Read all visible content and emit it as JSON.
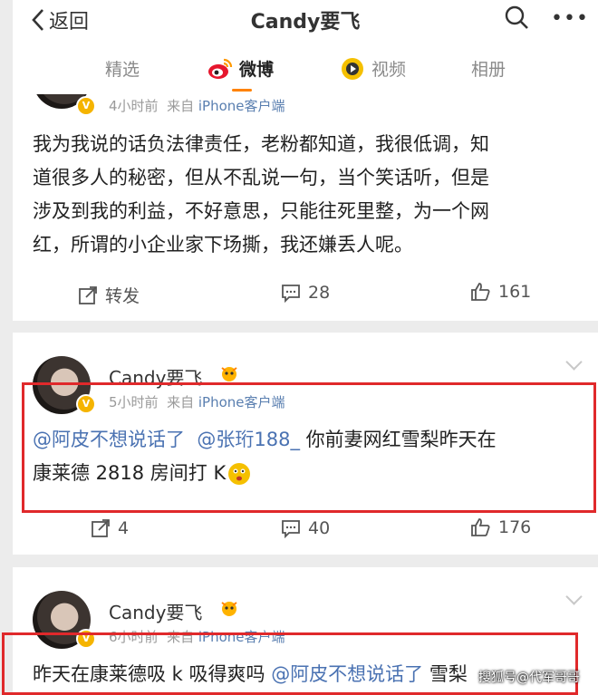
{
  "header": {
    "back_label": "返回",
    "title": "Candy要飞"
  },
  "tabs": [
    {
      "label": "精选"
    },
    {
      "label": "微博"
    },
    {
      "label": "视频"
    },
    {
      "label": "相册"
    }
  ],
  "posts": [
    {
      "meta_time": "4小时前",
      "meta_from": "来自",
      "meta_source": "iPhone客户端",
      "text_lines": [
        "我为我说的话负法律责任，老粉都知道，我很低调，知",
        "道很多人的秘密，但从不乱说一句，当个笑话听，但是",
        "涉及到我的利益，不好意思，只能往死里整，为一个网",
        "红，所谓的小企业家下场撕，我还嫌丢人呢。"
      ],
      "actions": {
        "repost": "转发",
        "comments": "28",
        "likes": "161"
      }
    },
    {
      "username": "Candy要飞",
      "meta_time": "5小时前",
      "meta_from": "来自",
      "meta_source": "iPhone客户端",
      "mention1": "@阿皮不想说话了",
      "mention2": "@张珩188_",
      "text_after": " 你前妻网红雪梨昨天在",
      "text_line2": "康莱德 2818 房间打 K",
      "actions": {
        "repost": "4",
        "comments": "40",
        "likes": "176"
      }
    },
    {
      "username": "Candy要飞",
      "meta_time": "6小时前",
      "meta_from": "来自",
      "meta_source": "iPhone客户端",
      "text_start": "昨天在康莱德吸 k 吸得爽吗 ",
      "mention1": "@阿皮不想说话了",
      "text_end": " 雪梨"
    }
  ],
  "watermark": "搜狐号@代军哥哥",
  "colors": {
    "accent": "#ff8200",
    "link": "#4a72b2",
    "highlight_box": "#e0292b"
  }
}
